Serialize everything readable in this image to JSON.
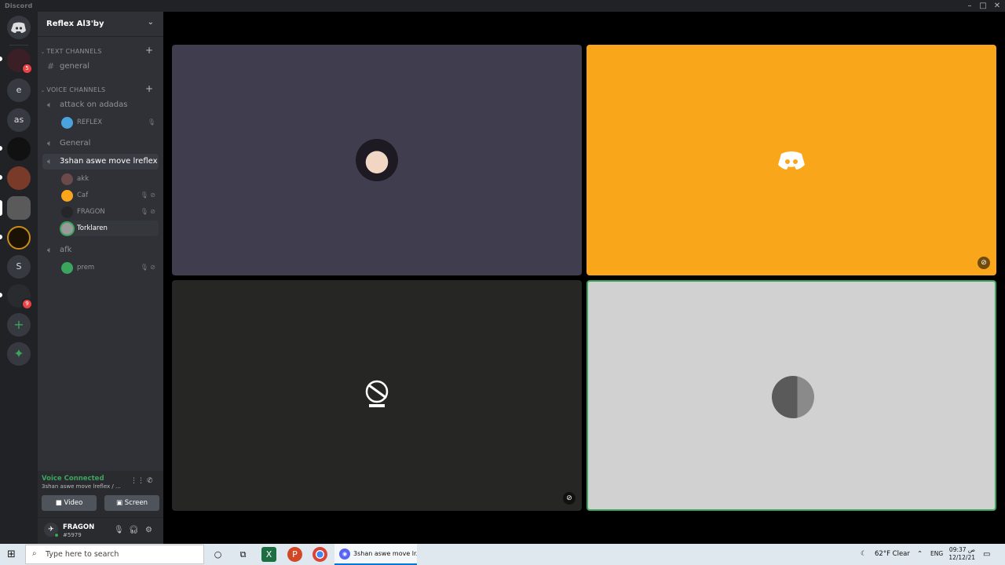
{
  "window": {
    "title": "Discord"
  },
  "guilds": [
    {
      "label": "",
      "badge": "5"
    },
    {
      "label": "e",
      "badge": ""
    },
    {
      "label": "as",
      "badge": ""
    },
    {
      "label": "",
      "badge": ""
    },
    {
      "label": "",
      "badge": ""
    },
    {
      "label": "",
      "badge": ""
    },
    {
      "label": "",
      "badge": ""
    },
    {
      "label": "S",
      "badge": ""
    },
    {
      "label": "",
      "badge": "9"
    }
  ],
  "server": {
    "name": "Reflex Al3'by"
  },
  "categories": {
    "text": "TEXT CHANNELS",
    "voice": "VOICE CHANNELS"
  },
  "text_channels": [
    {
      "name": "general"
    }
  ],
  "voice_channels": [
    {
      "name": "attack on adadas"
    },
    {
      "name": "General"
    },
    {
      "name": "3shan aswe move lreflex"
    },
    {
      "name": "afk"
    }
  ],
  "voice_users": {
    "attack": [
      {
        "name": "REFLEX"
      }
    ],
    "move": [
      {
        "name": "akk"
      },
      {
        "name": "Caf"
      },
      {
        "name": "FRAGON"
      },
      {
        "name": "Torklaren"
      }
    ],
    "afk": [
      {
        "name": "prem"
      }
    ]
  },
  "voice_panel": {
    "status": "Voice Connected",
    "channel": "3shan aswe move lreflex / ...",
    "video_label": "Video",
    "screen_label": "Screen"
  },
  "user_panel": {
    "name": "FRAGON",
    "tag": "#5979"
  },
  "taskbar": {
    "search_placeholder": "Type here to search",
    "active_app": "3shan aswe move lr...",
    "weather": "62°F  Clear",
    "lang": "ENG",
    "time": "09:37 ص",
    "date": "12/12/21"
  },
  "colors": {
    "accent": "#5865f2",
    "online": "#3ba55d",
    "tile_purple": "#403d4f",
    "tile_orange": "#faa61a",
    "tile_dark": "#262624",
    "tile_light": "#d1d1d1"
  }
}
